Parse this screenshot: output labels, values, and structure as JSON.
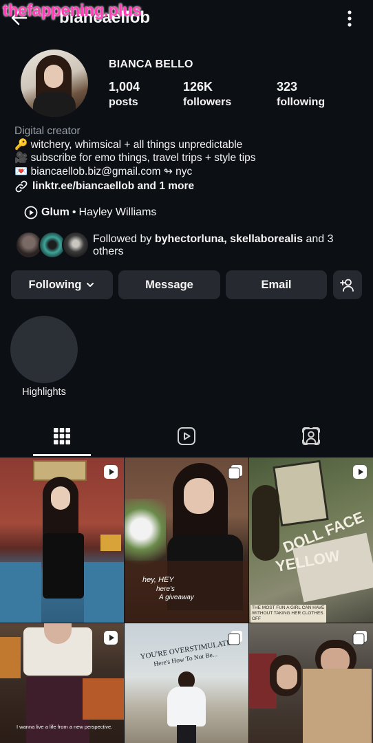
{
  "watermark": "thefappening.plus",
  "header": {
    "username": "biancaellob"
  },
  "profile": {
    "display_name": "BIANCA BELLO",
    "stats": [
      {
        "value": "1,004",
        "label": "posts"
      },
      {
        "value": "126K",
        "label": "followers"
      },
      {
        "value": "323",
        "label": "following"
      }
    ]
  },
  "bio": {
    "category": "Digital creator",
    "lines": [
      "🔑 witchery, whimsical + all things unpredictable",
      "🎥 subscribe for emo things, travel trips + style tips",
      "💌 biancaellob.biz@gmail.com ↬ nyc"
    ],
    "link": "linktr.ee/biancaellob and 1 more"
  },
  "music": {
    "song": "Glum",
    "separator": "•",
    "artist": "Hayley Williams"
  },
  "followed_by": {
    "prefix": "Followed by ",
    "names": "byhectorluna, skellaborealis",
    "suffix": " and 3 others"
  },
  "buttons": {
    "following": "Following",
    "message": "Message",
    "email": "Email"
  },
  "highlights": {
    "label": "Highlights"
  },
  "grid": {
    "captions": {
      "post2_a": "hey, HEY",
      "post2_b": "here's",
      "post2_c": "A giveaway",
      "post3_a": "DOLL FACE",
      "post3_b": "YELLOW",
      "post3_c": "THE MOST FUN A GIRL CAN HAVE WITHOUT TAKING HER CLOTHES OFF",
      "post4": "I wanna live a life from a new perspective.",
      "post5_a": "YOU'RE OVERSTIMULATED",
      "post5_b": "Here's How To Not Be..."
    }
  },
  "colors": {
    "background": "#0c0f14",
    "button": "#26292f",
    "watermark": "#ff3fb6"
  }
}
